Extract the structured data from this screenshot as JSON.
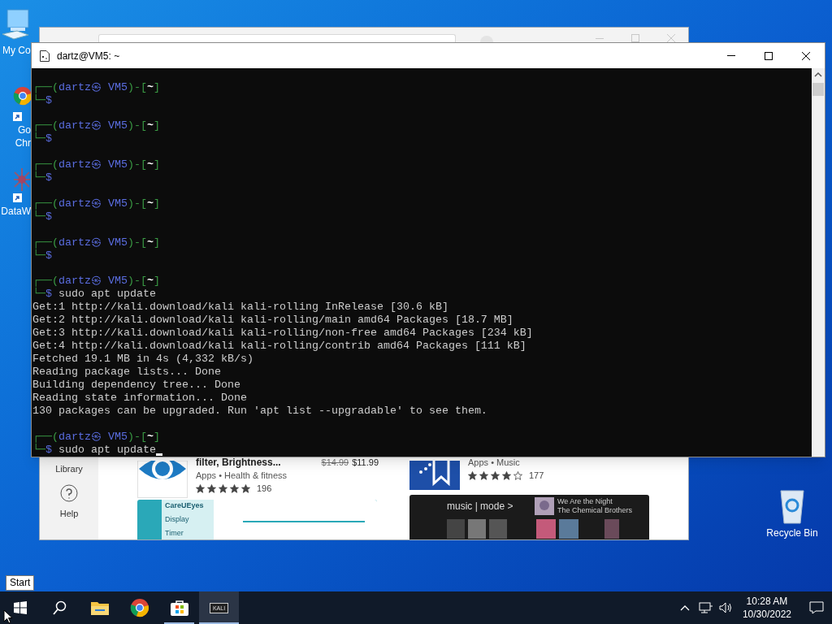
{
  "desktop_icons": [
    {
      "kind": "computer",
      "lines": [
        "My Co"
      ]
    },
    {
      "kind": "chrome",
      "lines": [
        "Go",
        "Chr"
      ]
    },
    {
      "kind": "dataw",
      "lines": [
        "DataW"
      ]
    },
    {
      "kind": "recycle",
      "lines": [
        "Recycle Bin"
      ]
    }
  ],
  "store_window": {
    "sidebar": [
      {
        "kind": "library",
        "label": "Library"
      },
      {
        "kind": "help",
        "label": "Help"
      }
    ],
    "apps": [
      {
        "kind": "eye",
        "title": "filter, Brightness...",
        "category": "Apps • Health & fitness",
        "old_price": "$14.99",
        "price": "$11.99",
        "stars": 5,
        "rating_count": "196",
        "preview": {
          "kind": "eyes",
          "texts": [
            "CareUEyes",
            "Display",
            "Timer"
          ]
        }
      },
      {
        "kind": "music",
        "category": "Apps • Music",
        "stars": 4,
        "rating_count": "177",
        "preview": {
          "kind": "music",
          "texts": [
            "music | mode >",
            "We Are the Night",
            "The Chemical Brothers"
          ]
        }
      }
    ]
  },
  "terminal": {
    "title": "dartz@VM5: ~",
    "cursor": true,
    "lines": [
      {
        "kind": "blank"
      },
      {
        "kind": "output",
        "segments": [
          {
            "kind": "frame",
            "text": "┌──("
          },
          {
            "kind": "user",
            "text": "dartz㉿ VM5"
          },
          {
            "kind": "frame",
            "text": ")-["
          },
          {
            "kind": "dir",
            "text": "~"
          },
          {
            "kind": "frame",
            "text": "]"
          }
        ]
      },
      {
        "kind": "output",
        "segments": [
          {
            "kind": "frame",
            "text": "└─"
          },
          {
            "kind": "sign",
            "text": "$"
          }
        ]
      },
      {
        "kind": "blank"
      },
      {
        "kind": "output",
        "segments": [
          {
            "kind": "frame",
            "text": "┌──("
          },
          {
            "kind": "user",
            "text": "dartz㉿ VM5"
          },
          {
            "kind": "frame",
            "text": ")-["
          },
          {
            "kind": "dir",
            "text": "~"
          },
          {
            "kind": "frame",
            "text": "]"
          }
        ]
      },
      {
        "kind": "output",
        "segments": [
          {
            "kind": "frame",
            "text": "└─"
          },
          {
            "kind": "sign",
            "text": "$"
          }
        ]
      },
      {
        "kind": "blank"
      },
      {
        "kind": "output",
        "segments": [
          {
            "kind": "frame",
            "text": "┌──("
          },
          {
            "kind": "user",
            "text": "dartz㉿ VM5"
          },
          {
            "kind": "frame",
            "text": ")-["
          },
          {
            "kind": "dir",
            "text": "~"
          },
          {
            "kind": "frame",
            "text": "]"
          }
        ]
      },
      {
        "kind": "output",
        "segments": [
          {
            "kind": "frame",
            "text": "└─"
          },
          {
            "kind": "sign",
            "text": "$"
          }
        ]
      },
      {
        "kind": "blank"
      },
      {
        "kind": "output",
        "segments": [
          {
            "kind": "frame",
            "text": "┌──("
          },
          {
            "kind": "user",
            "text": "dartz㉿ VM5"
          },
          {
            "kind": "frame",
            "text": ")-["
          },
          {
            "kind": "dir",
            "text": "~"
          },
          {
            "kind": "frame",
            "text": "]"
          }
        ]
      },
      {
        "kind": "output",
        "segments": [
          {
            "kind": "frame",
            "text": "└─"
          },
          {
            "kind": "sign",
            "text": "$"
          }
        ]
      },
      {
        "kind": "blank"
      },
      {
        "kind": "output",
        "segments": [
          {
            "kind": "frame",
            "text": "┌──("
          },
          {
            "kind": "user",
            "text": "dartz㉿ VM5"
          },
          {
            "kind": "frame",
            "text": ")-["
          },
          {
            "kind": "dir",
            "text": "~"
          },
          {
            "kind": "frame",
            "text": "]"
          }
        ]
      },
      {
        "kind": "output",
        "segments": [
          {
            "kind": "frame",
            "text": "└─"
          },
          {
            "kind": "sign",
            "text": "$"
          }
        ]
      },
      {
        "kind": "blank"
      },
      {
        "kind": "output",
        "segments": [
          {
            "kind": "frame",
            "text": "┌──("
          },
          {
            "kind": "user",
            "text": "dartz㉿ VM5"
          },
          {
            "kind": "frame",
            "text": ")-["
          },
          {
            "kind": "dir",
            "text": "~"
          },
          {
            "kind": "frame",
            "text": "]"
          }
        ]
      },
      {
        "kind": "output",
        "segments": [
          {
            "kind": "frame",
            "text": "└─"
          },
          {
            "kind": "sign",
            "text": "$"
          },
          {
            "kind": "text",
            "text": " sudo apt update"
          }
        ]
      },
      {
        "kind": "output",
        "segments": [
          {
            "kind": "text",
            "text": "Get:1 http://kali.download/kali kali-rolling InRelease [30.6 kB]"
          }
        ]
      },
      {
        "kind": "output",
        "segments": [
          {
            "kind": "text",
            "text": "Get:2 http://kali.download/kali kali-rolling/main amd64 Packages [18.7 MB]"
          }
        ]
      },
      {
        "kind": "output",
        "segments": [
          {
            "kind": "text",
            "text": "Get:3 http://kali.download/kali kali-rolling/non-free amd64 Packages [234 kB]"
          }
        ]
      },
      {
        "kind": "output",
        "segments": [
          {
            "kind": "text",
            "text": "Get:4 http://kali.download/kali kali-rolling/contrib amd64 Packages [111 kB]"
          }
        ]
      },
      {
        "kind": "output",
        "segments": [
          {
            "kind": "text",
            "text": "Fetched 19.1 MB in 4s (4,332 kB/s)"
          }
        ]
      },
      {
        "kind": "output",
        "segments": [
          {
            "kind": "text",
            "text": "Reading package lists... Done"
          }
        ]
      },
      {
        "kind": "output",
        "segments": [
          {
            "kind": "text",
            "text": "Building dependency tree... Done"
          }
        ]
      },
      {
        "kind": "output",
        "segments": [
          {
            "kind": "text",
            "text": "Reading state information... Done"
          }
        ]
      },
      {
        "kind": "output",
        "segments": [
          {
            "kind": "text",
            "text": "130 packages can be upgraded. Run 'apt list --upgradable' to see them."
          }
        ]
      },
      {
        "kind": "blank"
      },
      {
        "kind": "output",
        "segments": [
          {
            "kind": "frame",
            "text": "┌──("
          },
          {
            "kind": "user",
            "text": "dartz㉿ VM5"
          },
          {
            "kind": "frame",
            "text": ")-["
          },
          {
            "kind": "dir",
            "text": "~"
          },
          {
            "kind": "frame",
            "text": "]"
          }
        ]
      },
      {
        "kind": "output",
        "segments": [
          {
            "kind": "frame",
            "text": "└─"
          },
          {
            "kind": "sign",
            "text": "$"
          },
          {
            "kind": "text",
            "text": " sudo apt update"
          }
        ]
      }
    ]
  },
  "tooltip": {
    "text": "Start"
  },
  "taskbar": {
    "items": [
      {
        "kind": "start",
        "selected": false
      },
      {
        "kind": "search",
        "selected": false
      },
      {
        "kind": "explorer",
        "selected": false
      },
      {
        "kind": "chrome",
        "selected": false
      },
      {
        "kind": "store",
        "selected": false,
        "running": true
      },
      {
        "kind": "kali",
        "label": "KALI",
        "selected": true,
        "running": true
      }
    ],
    "clock": {
      "time": "10:28 AM",
      "date": "10/30/2022"
    }
  }
}
